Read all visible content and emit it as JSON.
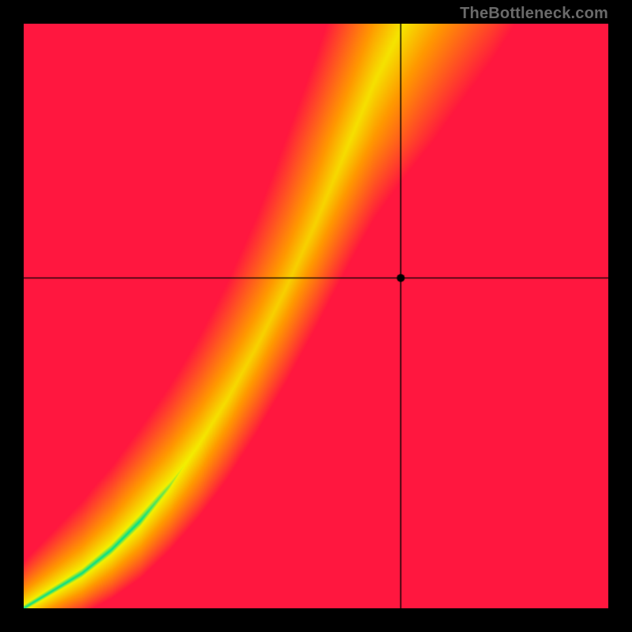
{
  "watermark": "TheBottleneck.com",
  "chart_data": {
    "type": "heatmap",
    "title": "",
    "xlabel": "",
    "ylabel": "",
    "xlim": [
      0,
      1
    ],
    "ylim": [
      0,
      1
    ],
    "grid": false,
    "legend": false,
    "axes_visible": false,
    "ridge": {
      "description": "Green optimal-balance ridge y = f(x); heat color = distance from ridge",
      "pts": [
        [
          0.0,
          0.0
        ],
        [
          0.05,
          0.03
        ],
        [
          0.1,
          0.06
        ],
        [
          0.15,
          0.1
        ],
        [
          0.2,
          0.15
        ],
        [
          0.25,
          0.21
        ],
        [
          0.3,
          0.28
        ],
        [
          0.35,
          0.36
        ],
        [
          0.4,
          0.45
        ],
        [
          0.45,
          0.55
        ],
        [
          0.5,
          0.66
        ],
        [
          0.55,
          0.78
        ],
        [
          0.6,
          0.9
        ],
        [
          0.65,
          1.0
        ]
      ]
    },
    "crosshair": {
      "x": 0.645,
      "y": 0.565
    },
    "marker": {
      "x": 0.645,
      "y": 0.565
    },
    "color_stops": {
      "on_ridge": "#00e08a",
      "near": "#f4f000",
      "mid": "#ff9a00",
      "far": "#ff173f"
    }
  }
}
